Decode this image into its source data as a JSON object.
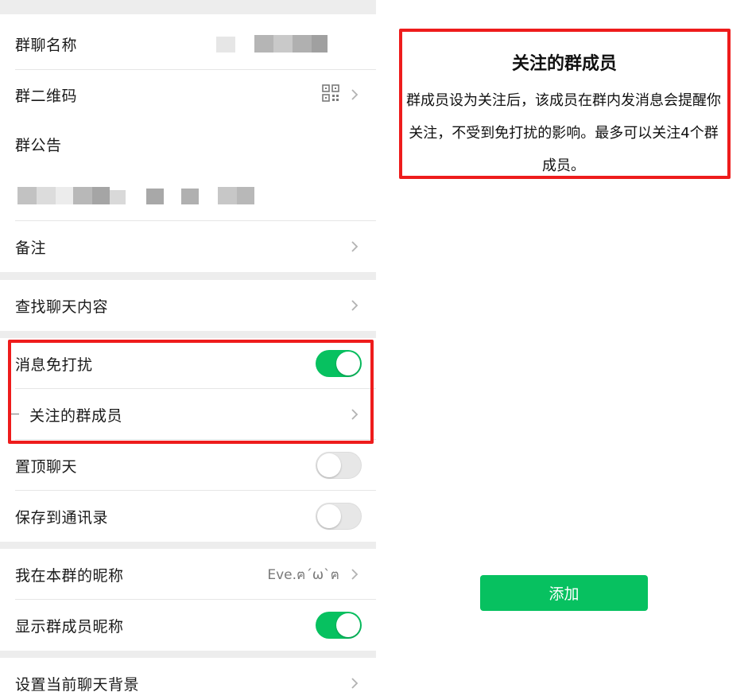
{
  "settings": {
    "group_name_label": "群聊名称",
    "qr_code_label": "群二维码",
    "announcement_label": "群公告",
    "remark_label": "备注",
    "search_chat_label": "查找聊天内容",
    "mute_label": "消息免打扰",
    "followed_members_label": "关注的群成员",
    "pin_chat_label": "置顶聊天",
    "save_contacts_label": "保存到通讯录",
    "my_nickname_label": "我在本群的昵称",
    "my_nickname_value": "Eve.ฅ´ω`ฅ",
    "show_nicknames_label": "显示群成员昵称",
    "chat_background_label": "设置当前聊天背景"
  },
  "toggles": {
    "mute": true,
    "pin_chat": false,
    "save_contacts": false,
    "show_nicknames": true
  },
  "info": {
    "title": "关注的群成员",
    "body": "群成员设为关注后，该成员在群内发消息会提醒你关注，不受到免打扰的影响。最多可以关注4个群成员。"
  },
  "add_button_label": "添加",
  "colors": {
    "accent": "#07c160",
    "highlight": "#ee1c1c"
  }
}
